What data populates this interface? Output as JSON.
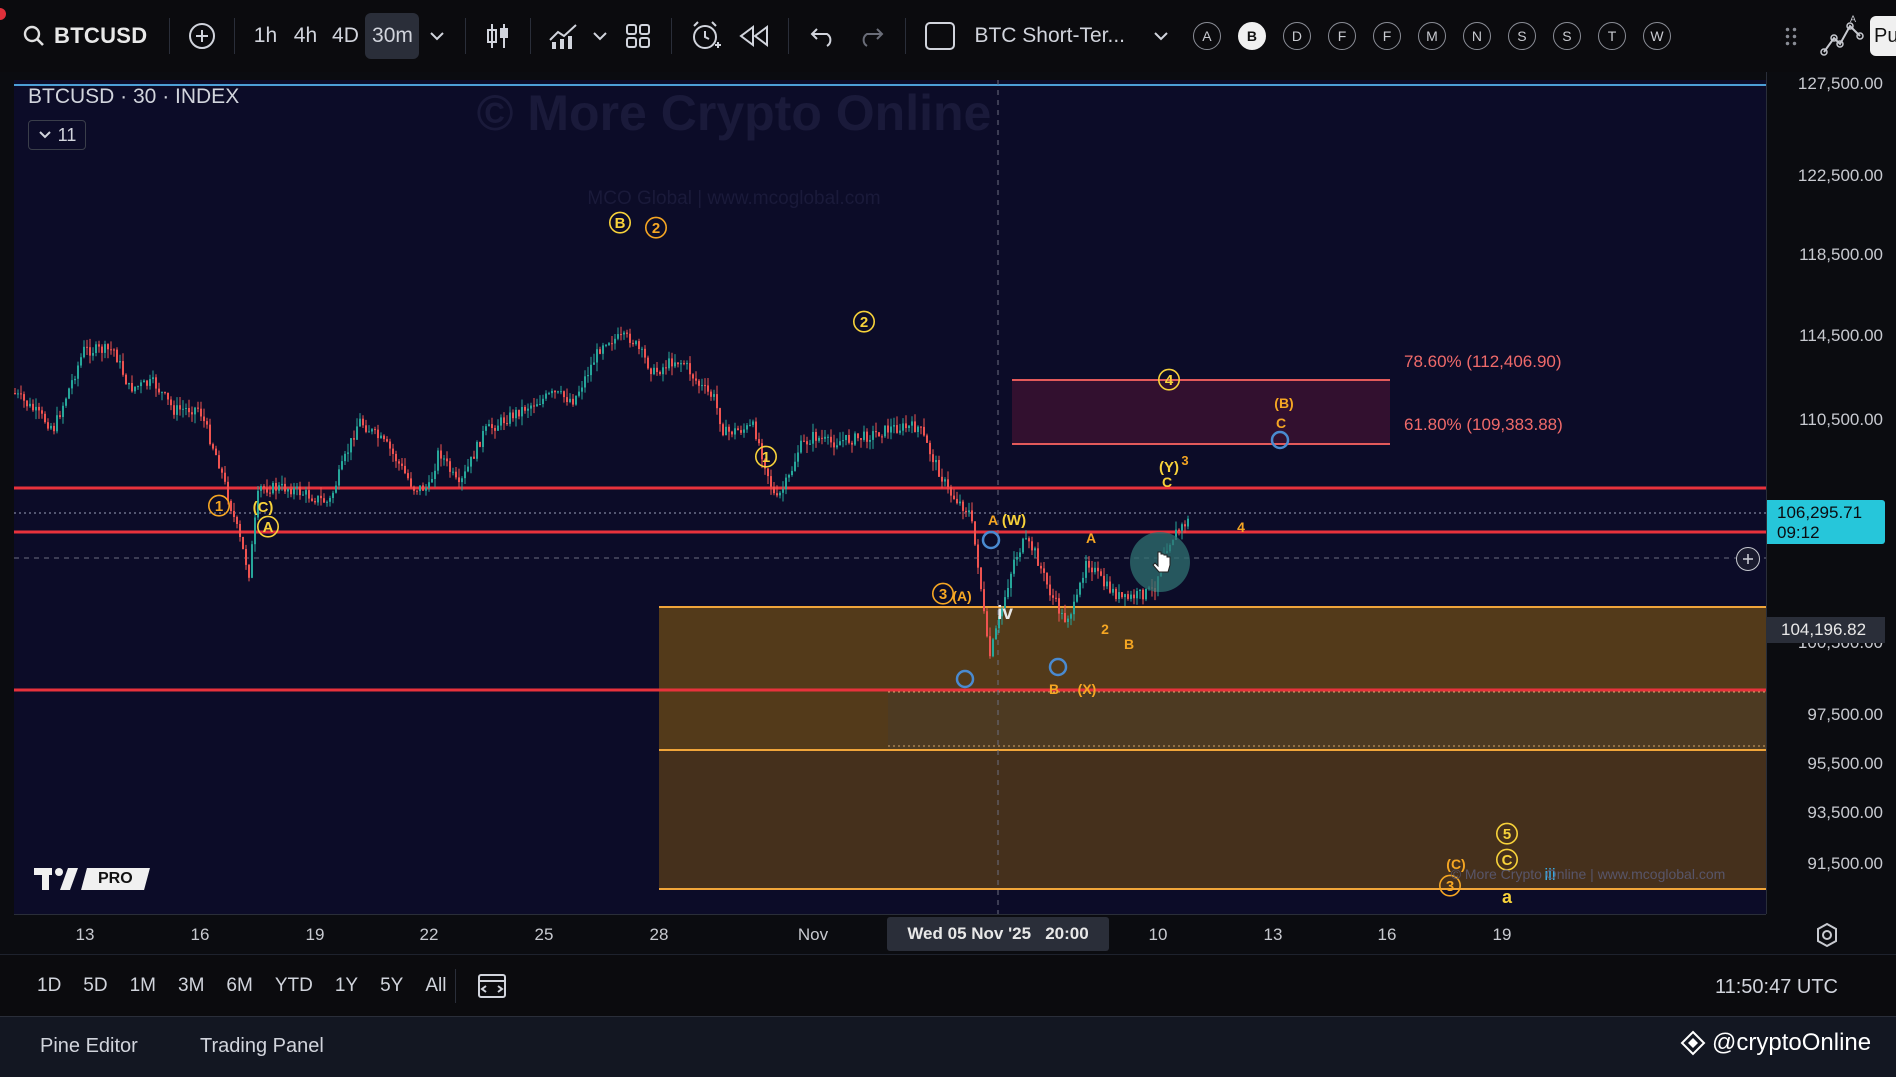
{
  "toolbar": {
    "symbol": "BTCUSD",
    "intervals": [
      "1h",
      "4h",
      "4D",
      "30m"
    ],
    "selected_interval": "30m",
    "layout_name": "BTC Short-Ter...",
    "letter_buttons": [
      "A",
      "B",
      "D",
      "F",
      "F",
      "M",
      "N",
      "S",
      "S",
      "T",
      "W"
    ],
    "active_letter": "B",
    "publish_label": "Pu"
  },
  "chart": {
    "legend_title": "BTCUSD · 30 · INDEX",
    "indicator_count": "11",
    "watermark_title": "© More Crypto Online",
    "watermark_sub": "MCO Global  |  www.mcoglobal.com",
    "bottom_watermark": "© More Crypto Online  |  www.mcoglobal.com",
    "fib_labels": [
      "78.60% (112,406.90)",
      "61.80% (109,383.88)"
    ],
    "logo_text": "PRO",
    "colors": {
      "background": "#0c0c28",
      "support_line": "#e8323c",
      "fib_line": "#e35a5a",
      "fib_text": "#f06a6a",
      "zone": "#7a5312",
      "zone_border": "#f0a53a",
      "wave_label": "#f5a623",
      "wave_label_yellow": "#f7d23a",
      "up_candle": "#26a69a",
      "down_candle": "#ef5350",
      "price_badge": "#26c6da"
    },
    "wave_labels": [
      {
        "text": "B",
        "circled": true
      },
      {
        "text": "2",
        "circled": true
      },
      {
        "text": "2",
        "circled": true
      },
      {
        "text": "1",
        "circled": true
      },
      {
        "text": "1",
        "circled": true
      },
      {
        "text": "(C)",
        "circled": false
      },
      {
        "text": "A",
        "circled": true
      },
      {
        "text": "3",
        "circled": true
      },
      {
        "text": "(A)",
        "circled": false
      },
      {
        "text": "iv",
        "circled": false
      },
      {
        "text": "A",
        "circled": false
      },
      {
        "text": "(W)",
        "circled": false
      },
      {
        "text": "B",
        "circled": false
      },
      {
        "text": "(X)",
        "circled": false
      },
      {
        "text": "A",
        "circled": false
      },
      {
        "text": "2",
        "circled": false
      },
      {
        "text": "B",
        "circled": false
      },
      {
        "text": "4",
        "circled": true
      },
      {
        "text": "(Y)",
        "circled": false
      },
      {
        "text": "3",
        "circled": false
      },
      {
        "text": "C",
        "circled": false
      },
      {
        "text": "4",
        "circled": false
      },
      {
        "text": "(B)",
        "circled": false
      },
      {
        "text": "C",
        "circled": false
      },
      {
        "text": "5",
        "circled": true
      },
      {
        "text": "C",
        "circled": true
      },
      {
        "text": "(C)",
        "circled": false
      },
      {
        "text": "3",
        "circled": true
      },
      {
        "text": "a",
        "circled": false
      },
      {
        "text": "iii",
        "circled": false
      }
    ]
  },
  "price_scale": {
    "labels": [
      "127,500.00",
      "122,500.00",
      "118,500.00",
      "114,500.00",
      "110,500.00",
      "100,500.00",
      "97,500.00",
      "95,500.00",
      "93,500.00",
      "91,500.00"
    ],
    "current_price": "106,295.71",
    "countdown": "09:12",
    "crosshair_price": "104,196.82"
  },
  "time_axis": {
    "labels": [
      "13",
      "16",
      "19",
      "22",
      "25",
      "28",
      "Nov",
      "10",
      "13",
      "16",
      "19"
    ],
    "crosshair_time": "Wed 05 Nov '25   20:00"
  },
  "bottom_bar": {
    "ranges": [
      "1D",
      "5D",
      "1M",
      "3M",
      "6M",
      "YTD",
      "1Y",
      "5Y",
      "All"
    ],
    "clock": "11:50:47 UTC"
  },
  "footer": {
    "tabs": [
      "Pine Editor",
      "Trading Panel"
    ],
    "handle": "@cryptoOnline"
  }
}
